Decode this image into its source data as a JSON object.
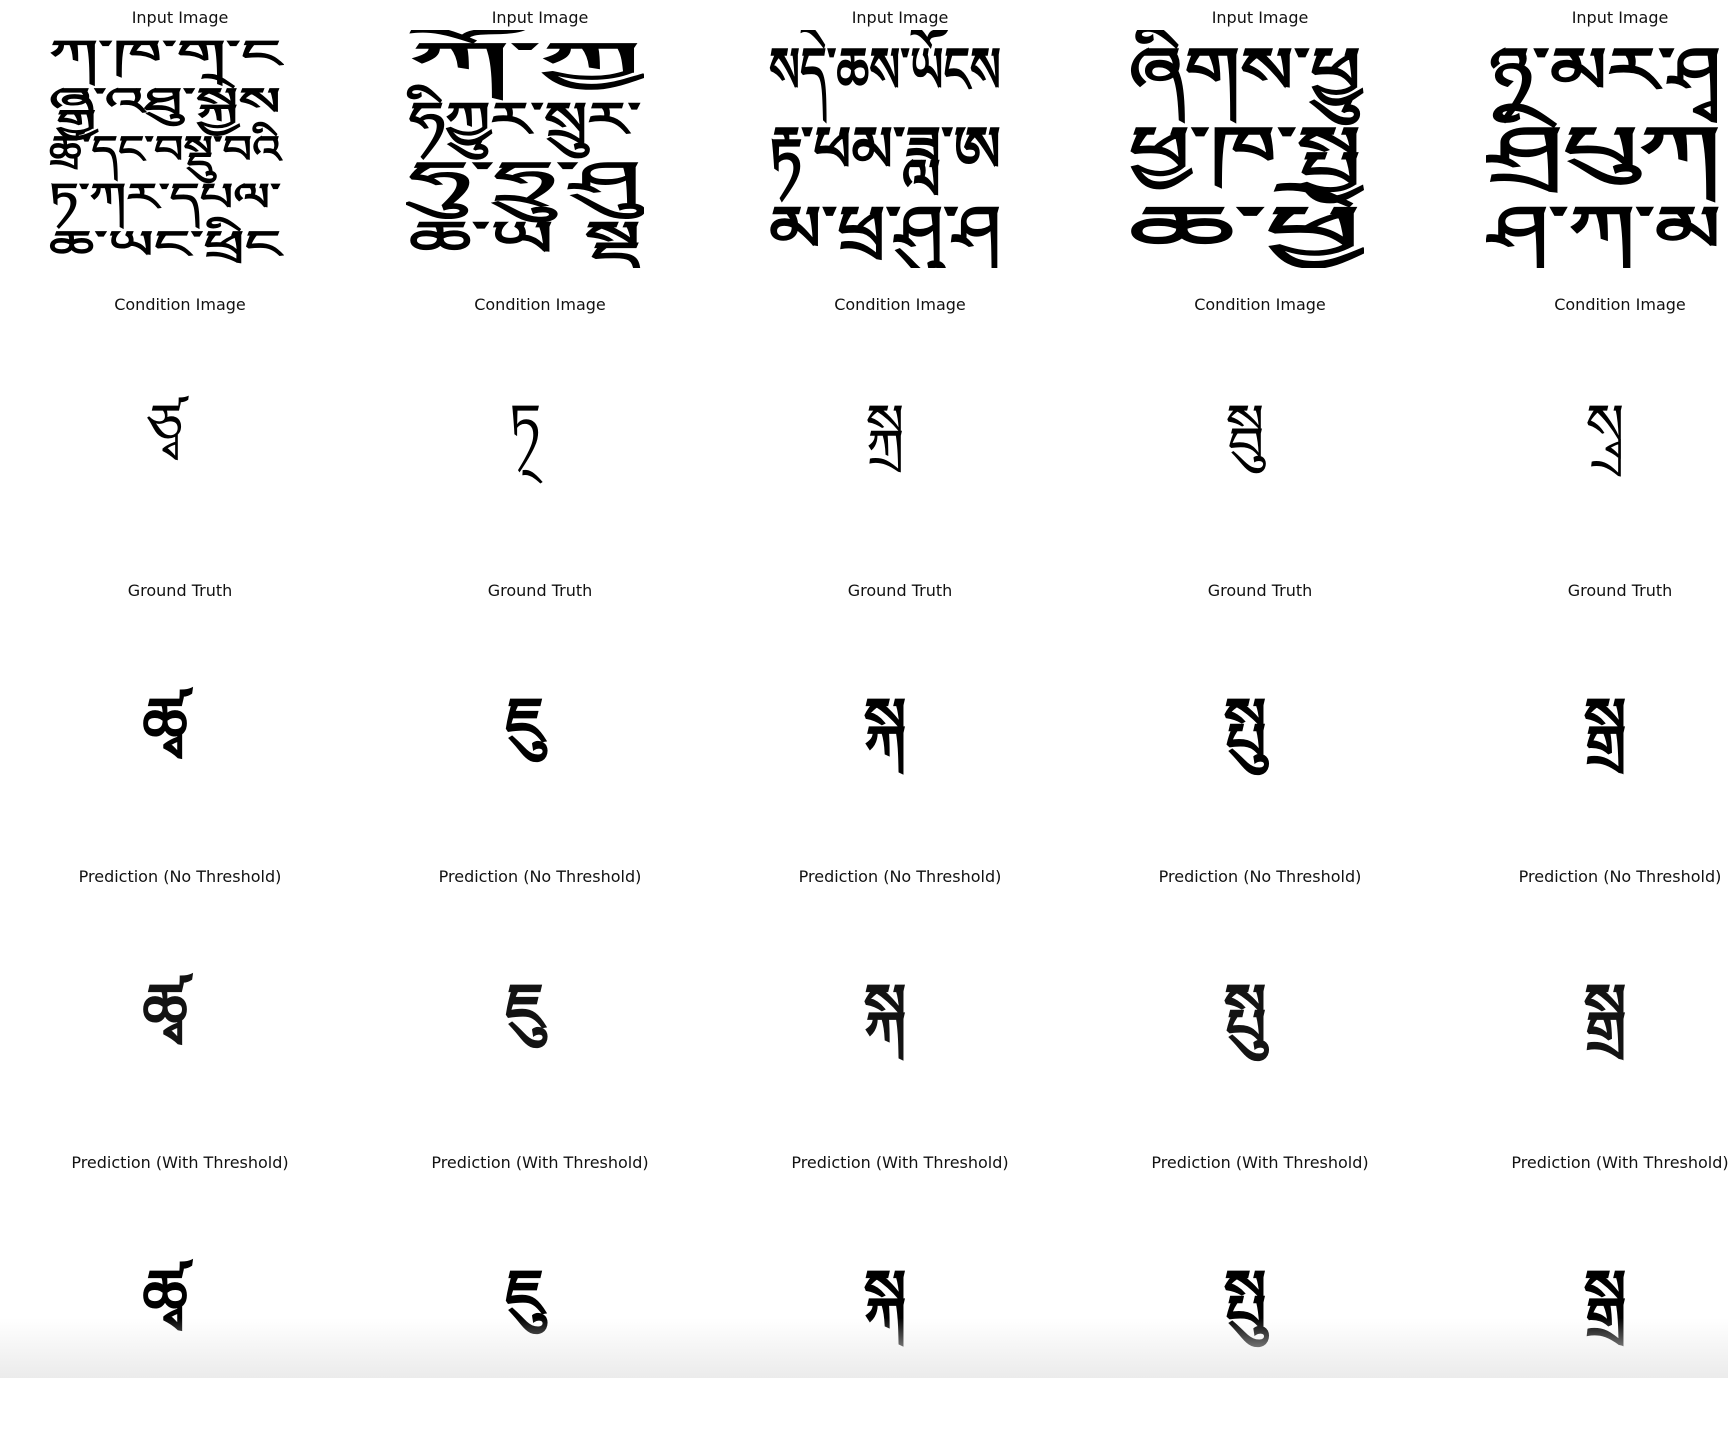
{
  "figure": {
    "row_titles": [
      "Input Image",
      "Condition Image",
      "Ground Truth",
      "Prediction (No Threshold)",
      "Prediction (With Threshold)"
    ],
    "columns": [
      {
        "input_text": [
          "ཀ་ཁ་ག་ང",
          "ཞྒྱ་འཐུ་སྐྱེས",
          "ཚྲ་དང་བསྡུ་བའི",
          "ཏ་ཀར་དཔལ་",
          "ཆ་ཡང་ཕྲིང"
        ],
        "condition_glyph": "ཙྭ",
        "result_glyph": "ཚྭ"
      },
      {
        "input_text": [
          "ཀོ་ཀྱ",
          "ཧིཀྱུར་སྲུར་",
          "ཧུ་ཧྲུ་ཤུ",
          "ཆ་ཡ   སྡ"
        ],
        "condition_glyph": "ཏ྄",
        "result_glyph": "ཇུ"
      },
      {
        "input_text": [
          "སདེ་ཆས་ཡོངས",
          "རྟ་ཕམ་ཟླ་ཨ",
          "མ་ཕྲ་ཤུ་ཤ"
        ],
        "condition_glyph": "སྐྲ",
        "result_glyph": "སྐ"
      },
      {
        "input_text": [
          "ཞིགས་ཕྱུ",
          "ཕྱ་ཁ་སྤྱ",
          "ཆ་ཕྱེ"
        ],
        "condition_glyph": "སྦུ",
        "result_glyph": "སྤུ"
      },
      {
        "input_text": [
          "ཉ་མར་ཤྭ",
          "ཤྲིཔུཀ",
          "ཤ་ཀ་མ"
        ],
        "condition_glyph": "སྭྲ",
        "result_glyph": "སྒྲ"
      }
    ]
  }
}
